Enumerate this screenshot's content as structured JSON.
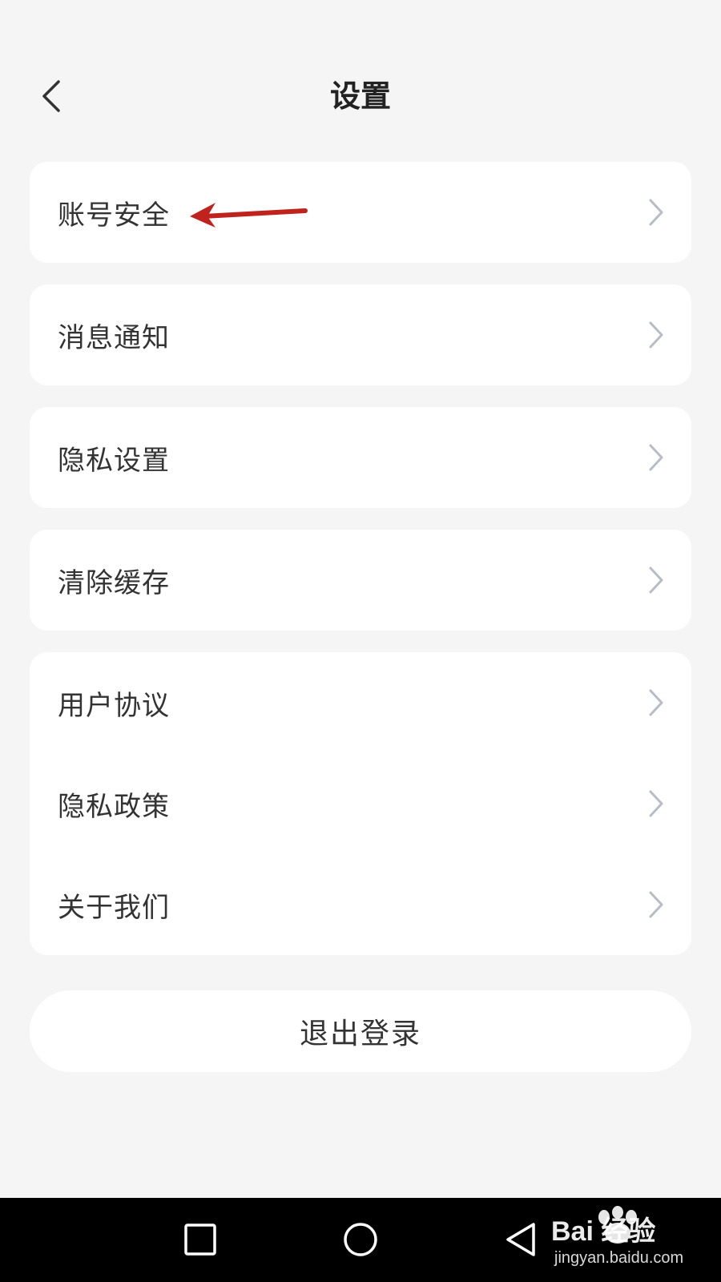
{
  "header": {
    "title": "设置",
    "back_icon": "chevron-left-icon"
  },
  "groups": [
    {
      "items": [
        {
          "label": "账号安全",
          "icon": "chevron-right-icon"
        }
      ]
    },
    {
      "items": [
        {
          "label": "消息通知",
          "icon": "chevron-right-icon"
        }
      ]
    },
    {
      "items": [
        {
          "label": "隐私设置",
          "icon": "chevron-right-icon"
        }
      ]
    },
    {
      "items": [
        {
          "label": "清除缓存",
          "icon": "chevron-right-icon"
        }
      ]
    },
    {
      "items": [
        {
          "label": "用户协议",
          "icon": "chevron-right-icon"
        },
        {
          "label": "隐私政策",
          "icon": "chevron-right-icon"
        },
        {
          "label": "关于我们",
          "icon": "chevron-right-icon"
        }
      ]
    }
  ],
  "logout": {
    "label": "退出登录"
  },
  "annotation": {
    "type": "red-arrow",
    "color": "#c0231d"
  },
  "navbar": {
    "buttons": [
      "recents-square-icon",
      "home-circle-icon",
      "back-triangle-icon"
    ]
  },
  "watermark": {
    "brand": "Bai 经验",
    "url": "jingyan.baidu.com"
  },
  "colors": {
    "background": "#f5f5f5",
    "card": "#ffffff",
    "text": "#333333",
    "chevron": "#b8bcc6",
    "navbar": "#000000"
  }
}
